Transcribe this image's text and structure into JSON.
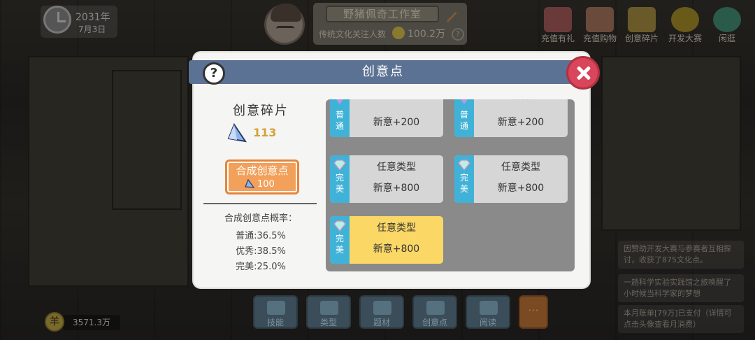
{
  "hud": {
    "year": "2031年",
    "date": "7月3日",
    "studio_name": "野猪佩奇工作室",
    "followers_label": "传统文化关注人数",
    "followers_value": "100.2万",
    "money": "3571.3万",
    "money_symbol": "羊",
    "top_icons": [
      {
        "label": "充值有礼",
        "icon": "gift-icon"
      },
      {
        "label": "充值购物",
        "icon": "shop-icon"
      },
      {
        "label": "创意碎片",
        "icon": "fragment-box-icon"
      },
      {
        "label": "开发大赛",
        "icon": "code-medal-icon"
      },
      {
        "label": "闲逛",
        "icon": "tree-icon"
      }
    ],
    "bottom_tabs": [
      {
        "label": "技能",
        "icon": "book-icon"
      },
      {
        "label": "类型",
        "icon": "gamepad-icon"
      },
      {
        "label": "题材",
        "icon": "script-icon"
      },
      {
        "label": "创意点",
        "icon": "diamond-icon"
      },
      {
        "label": "阅读",
        "icon": "reading-icon"
      }
    ],
    "more_label": "···",
    "news": [
      "因赞助开发大赛与参赛者互相探讨，收获了875文化点。",
      "一趟科学实验实践馆之旅唤醒了小时候当科学家的梦想",
      "本月账单[79万]已支付（详情可点击头像查看月消费）"
    ]
  },
  "modal": {
    "title": "创意点",
    "help_symbol": "?",
    "fragment_title": "创意碎片",
    "fragment_count": "113",
    "synth_label": "合成创意点",
    "synth_cost": "100",
    "prob_title": "合成创意点概率：",
    "probabilities": [
      "普通:36.5%",
      "优秀:38.5%",
      "完美:25.0%"
    ],
    "cards": [
      {
        "rarity": "普通",
        "type": "红色",
        "value": "新意+200",
        "highlight": false
      },
      {
        "rarity": "普通",
        "type": "横屏",
        "value": "新意+200",
        "highlight": false
      },
      {
        "rarity": "完美",
        "type": "任意类型",
        "value": "新意+800",
        "highlight": false
      },
      {
        "rarity": "完美",
        "type": "任意类型",
        "value": "新意+800",
        "highlight": false
      },
      {
        "rarity": "完美",
        "type": "任意类型",
        "value": "新意+800",
        "highlight": true
      }
    ]
  },
  "colors": {
    "header": "#5c7294",
    "synth_button": "#f2a05a",
    "rarity_strip": "#40b2d8",
    "highlight_card": "#fbd766",
    "close": "#d9455a"
  }
}
